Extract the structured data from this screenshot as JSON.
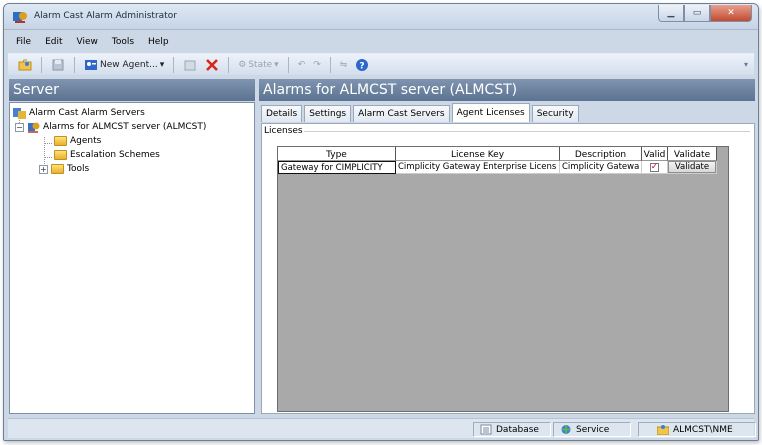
{
  "window": {
    "title": "Alarm Cast Alarm Administrator"
  },
  "menu": [
    "File",
    "Edit",
    "View",
    "Tools",
    "Help"
  ],
  "toolbar": {
    "new_agent_label": "New Agent...",
    "state_label": "State"
  },
  "left_panel": {
    "header": "Server",
    "tree": {
      "root_label": "Alarm Cast Alarm Servers",
      "server_label": "Alarms for ALMCST server (ALMCST)",
      "children": [
        "Agents",
        "Escalation Schemes",
        "Tools"
      ]
    }
  },
  "right_panel": {
    "header": "Alarms for ALMCST server (ALMCST)",
    "tabs": [
      "Details",
      "Settings",
      "Alarm Cast Servers",
      "Agent Licenses",
      "Security"
    ],
    "active_tab": "Agent Licenses",
    "group_label": "Licenses",
    "grid": {
      "columns": [
        "Type",
        "License Key",
        "Description",
        "Valid",
        "Validate"
      ],
      "rows": [
        {
          "type": "Gateway for CIMPLICITY",
          "license_key": "Cimplicity Gateway Enterprise Licens",
          "description": "Cimplicity Gatewa",
          "valid": true,
          "validate_label": "Validate"
        }
      ]
    }
  },
  "statusbar": {
    "database": "Database",
    "service": "Service",
    "user": "ALMCST\\NME"
  },
  "colors": {
    "header_bg": "#6d84a3",
    "window_bg": "#cdd8e6",
    "grid_bg": "#a9a9a9",
    "valid_check": "#c8102e"
  }
}
